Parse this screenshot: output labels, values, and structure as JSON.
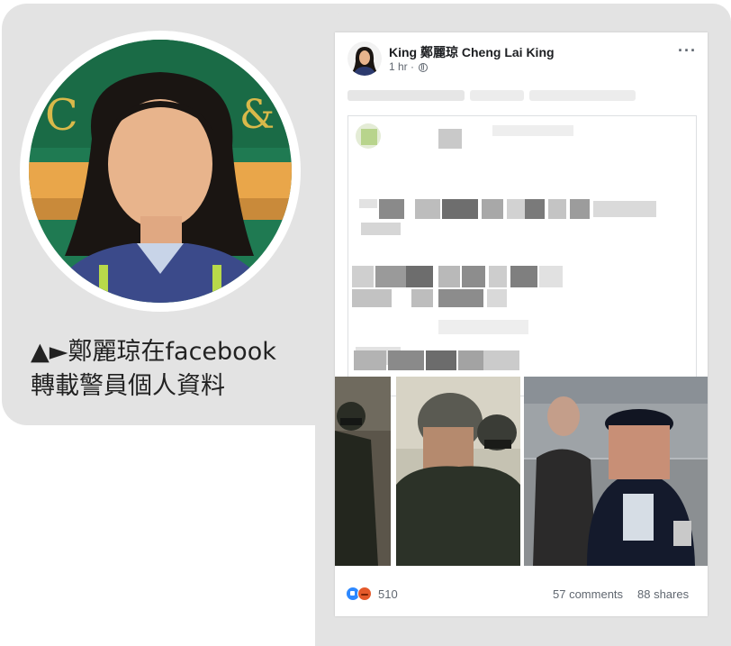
{
  "caption": {
    "line1": "▲►鄭麗琼在facebook",
    "line2": "轉載警員個人資料"
  },
  "post": {
    "author": "King 鄭麗琼 Cheng Lai King",
    "time": "1 hr ·",
    "more_label": "···",
    "reactions": {
      "count": "510",
      "icons": [
        "like-icon",
        "angry-icon"
      ]
    },
    "comments": "57 comments",
    "shares": "88 shares"
  },
  "colors": {
    "background_grey": "#e3e3e3",
    "facebook_blue": "#2d88ff",
    "angry_orange": "#e4592a",
    "meta_grey": "#606770"
  }
}
